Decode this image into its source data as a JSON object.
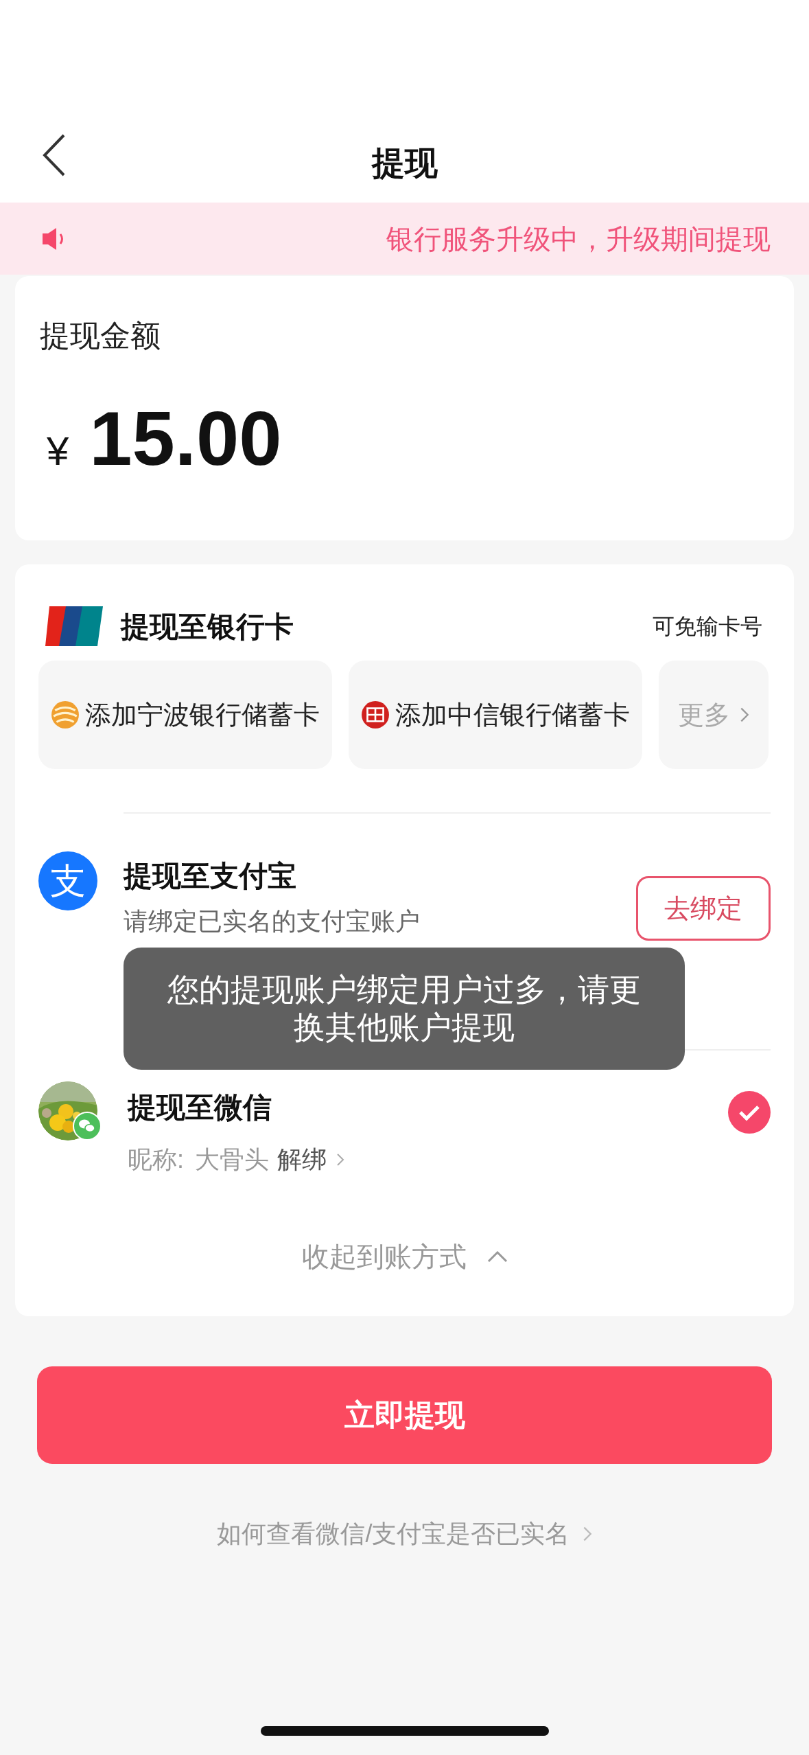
{
  "header": {
    "title": "提现"
  },
  "notice": {
    "text": "银行服务升级中，升级期间提现"
  },
  "amount": {
    "label": "提现金额",
    "currency": "¥",
    "value": "15.00"
  },
  "methods": [
    {
      "kind": "bank",
      "title": "提现至银行卡",
      "note": "可免输卡号",
      "selected": false,
      "chips": [
        {
          "kind": "ningbo",
          "label": "添加宁波银行储蓄卡"
        },
        {
          "kind": "citic",
          "label": "添加中信银行储蓄卡"
        },
        {
          "kind": "more",
          "label": "更多"
        }
      ]
    },
    {
      "kind": "alipay",
      "title": "提现至支付宝",
      "icon_glyph": "支",
      "subtitle": "请绑定已实名的支付宝账户",
      "action": "去绑定",
      "selected": false
    },
    {
      "kind": "wechat",
      "title": "提现至微信",
      "nickname_label": "昵称:",
      "nickname": "大骨头",
      "unbind": "解绑",
      "selected": true
    }
  ],
  "collapse": "收起到账方式",
  "submit": "立即提现",
  "help_link": "如何查看微信/支付宝是否已实名",
  "toast": "您的提现账户绑定用户过多，请更换其他账户提现"
}
